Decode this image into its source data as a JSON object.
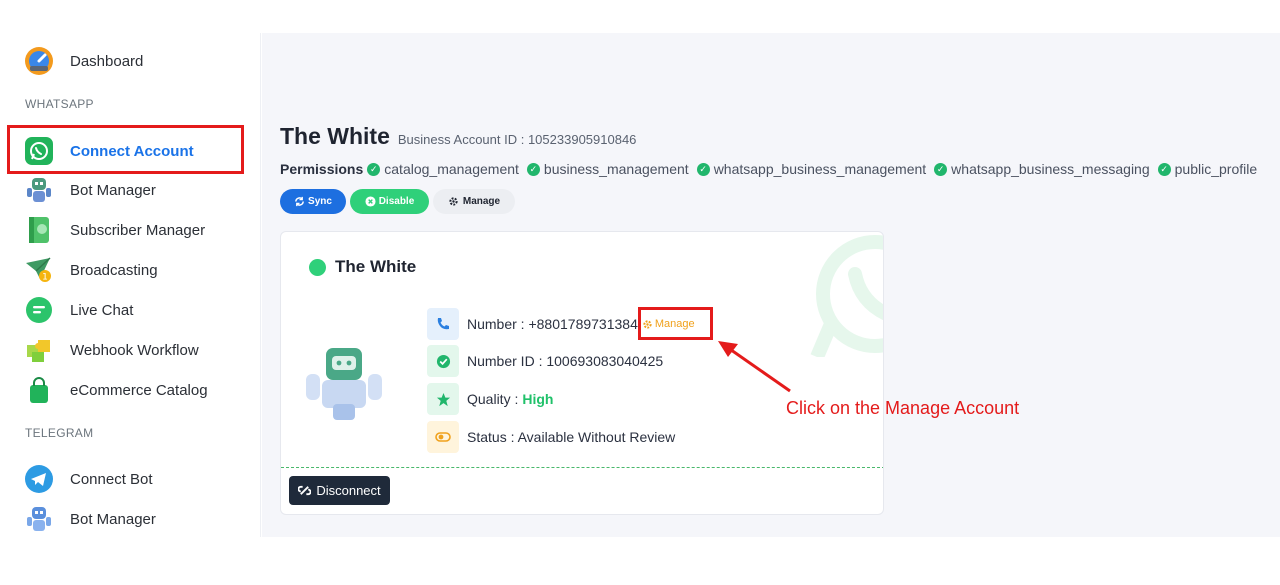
{
  "sidebar": {
    "dashboard": "Dashboard",
    "section_whatsapp": "WHATSAPP",
    "connect_account": "Connect Account",
    "bot_manager": "Bot Manager",
    "subscriber_manager": "Subscriber Manager",
    "broadcasting": "Broadcasting",
    "live_chat": "Live Chat",
    "webhook_workflow": "Webhook Workflow",
    "ecommerce_catalog": "eCommerce Catalog",
    "section_telegram": "TELEGRAM",
    "connect_bot": "Connect Bot",
    "telegram_bot_manager": "Bot Manager"
  },
  "account": {
    "name": "The White",
    "business_id": "Business Account ID : 105233905910846",
    "permissions_label": "Permissions",
    "permissions": [
      "catalog_management",
      "business_management",
      "whatsapp_business_management",
      "whatsapp_business_messaging",
      "public_profile"
    ],
    "sync_label": "Sync",
    "disable_label": "Disable",
    "manage_label": "Manage"
  },
  "card": {
    "title": "The White",
    "number": "Number : +8801789731384",
    "number_manage": "Manage",
    "number_id": "Number ID : 100693083040425",
    "quality_label": "Quality :",
    "quality_value": "High",
    "status": "Status : Available Without Review",
    "disconnect_label": "Disconnect"
  },
  "annotation": {
    "text": "Click on the Manage Account",
    "color": "#e41b1b"
  }
}
